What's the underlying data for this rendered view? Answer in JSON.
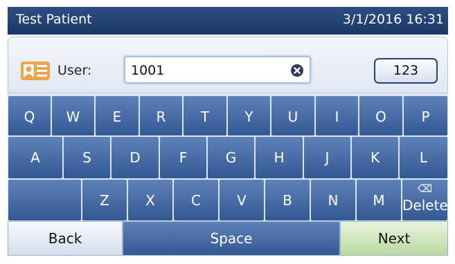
{
  "header": {
    "patient_name": "Test Patient",
    "datetime": "3/1/2016 16:31"
  },
  "user_panel": {
    "label": "User:",
    "value": "1001",
    "mode_button": "123",
    "id_icon": "id-card-icon",
    "clear_icon": "clear-x-icon"
  },
  "keyboard": {
    "row1": [
      "Q",
      "W",
      "E",
      "R",
      "T",
      "Y",
      "U",
      "I",
      "O",
      "P"
    ],
    "row2": [
      "A",
      "S",
      "D",
      "F",
      "G",
      "H",
      "J",
      "K",
      "L"
    ],
    "row3": [
      "Z",
      "X",
      "C",
      "V",
      "B",
      "N",
      "M"
    ],
    "delete_label": "Delete",
    "delete_icon": "backspace-icon"
  },
  "bottom": {
    "back": "Back",
    "space": "Space",
    "next": "Next"
  },
  "colors": {
    "title_bar": "#1f3b6c",
    "key": "#4a6fa8",
    "next_button": "#c7e0b2",
    "mode_border": "#27426f"
  }
}
